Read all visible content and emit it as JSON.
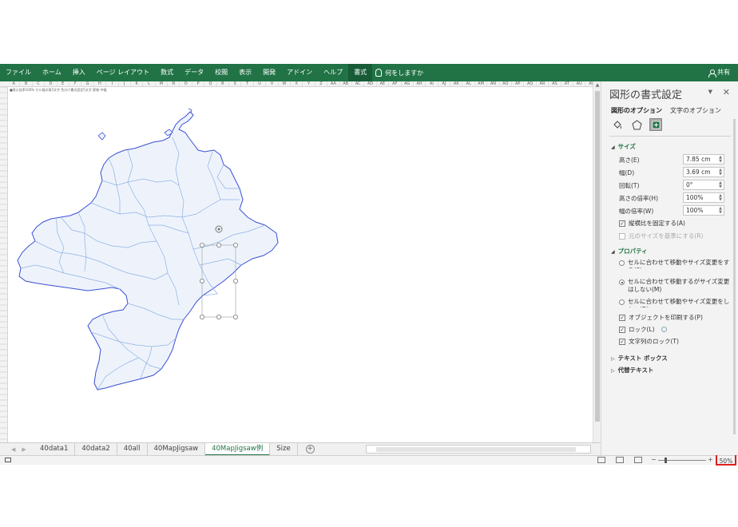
{
  "ribbon": {
    "tabs": [
      "ファイル",
      "ホーム",
      "挿入",
      "ページ レイアウト",
      "数式",
      "データ",
      "校閲",
      "表示",
      "開発",
      "アドイン",
      "ヘルプ",
      "書式"
    ],
    "active_tab": "書式",
    "tell_me": "何をしますか",
    "share": "共有",
    "color": "#217346"
  },
  "sheet": {
    "columns": [
      "A",
      "B",
      "C",
      "D",
      "E",
      "F",
      "G",
      "H",
      "I",
      "J",
      "K",
      "L",
      "M",
      "N",
      "O",
      "P",
      "Q",
      "R",
      "S",
      "T",
      "U",
      "V",
      "W",
      "X",
      "Y",
      "Z",
      "AA",
      "AB",
      "AC",
      "AD",
      "AE",
      "AF",
      "AG",
      "AH",
      "AI",
      "AJ",
      "AK",
      "AL",
      "AM",
      "AN",
      "AO",
      "AP",
      "AQ",
      "AR",
      "AS",
      "AT",
      "AU",
      "AV"
    ],
    "cell_note": "■表示倍率100% セル幅半角5文字 色分け書式設定5文字 罫線 中幅",
    "map_fill": "#eef3fb",
    "map_stroke": "#3a4fd6"
  },
  "sheet_tabs": {
    "tabs": [
      "40data1",
      "40data2",
      "40all",
      "40MapJigsaw",
      "40MapJigsaw例",
      "Size"
    ],
    "active": "40MapJigsaw例"
  },
  "status": {
    "zoom": "50%",
    "zoom_fraction": 0.5
  },
  "format_pane": {
    "title": "図形の書式設定",
    "tabs": [
      "図形のオプション",
      "文字のオプション"
    ],
    "active_tab": "図形のオプション",
    "icons": [
      "fill-line-icon",
      "effects-icon",
      "size-properties-icon"
    ],
    "size_section": "サイズ",
    "fields": [
      {
        "label": "高さ(E)",
        "value": "7.85 cm"
      },
      {
        "label": "幅(D)",
        "value": "3.69 cm"
      },
      {
        "label": "回転(T)",
        "value": "0°"
      },
      {
        "label": "高さの倍率(H)",
        "value": "100%"
      },
      {
        "label": "幅の倍率(W)",
        "value": "100%"
      }
    ],
    "lock_aspect": "縦横比を固定する(A)",
    "relative_original": "元のサイズを基準にする(R)",
    "properties_section": "プロパティ",
    "radios": [
      {
        "label": "セルに合わせて移動やサイズ変更をする(S)",
        "checked": false
      },
      {
        "label": "セルに合わせて移動するがサイズ変更はしない(M)",
        "checked": true
      },
      {
        "label": "セルに合わせて移動やサイズ変更をしない(D)",
        "checked": false
      }
    ],
    "print_object": "オブジェクトを印刷する(P)",
    "locked": "ロック(L)",
    "lock_text": "文字列のロック(T)",
    "textbox_section": "テキスト ボックス",
    "alt_text_section": "代替テキスト"
  }
}
